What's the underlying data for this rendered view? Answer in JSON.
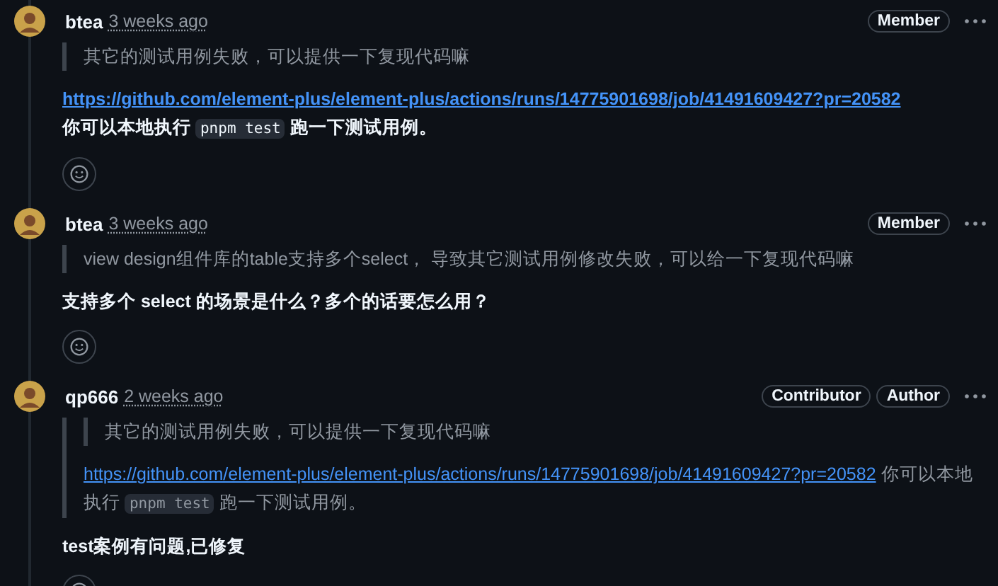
{
  "comments": [
    {
      "author": "btea",
      "time": "3 weeks ago",
      "badges": [
        "Member"
      ],
      "blocks": [
        {
          "kind": "quote",
          "children": [
            {
              "kind": "paragraph",
              "parts": [
                {
                  "kind": "text",
                  "text": "其它的测试用例失败，可以提供一下复现代码嘛"
                }
              ]
            }
          ]
        },
        {
          "kind": "paragraph",
          "parts": [
            {
              "kind": "link",
              "text": "https://github.com/element-plus/element-plus/actions/runs/14775901698/job/41491609427?pr=20582"
            },
            {
              "kind": "break"
            },
            {
              "kind": "text",
              "text": "你可以本地执行 "
            },
            {
              "kind": "code",
              "text": "pnpm test"
            },
            {
              "kind": "text",
              "text": " 跑一下测试用例。"
            }
          ]
        }
      ]
    },
    {
      "author": "btea",
      "time": "3 weeks ago",
      "badges": [
        "Member"
      ],
      "blocks": [
        {
          "kind": "quote",
          "children": [
            {
              "kind": "paragraph",
              "parts": [
                {
                  "kind": "text",
                  "text": "view design组件库的table支持多个select， 导致其它测试用例修改失败，可以给一下复现代码嘛"
                }
              ]
            }
          ]
        },
        {
          "kind": "paragraph",
          "parts": [
            {
              "kind": "text",
              "text": "支持多个 select 的场景是什么？多个的话要怎么用？"
            }
          ]
        }
      ]
    },
    {
      "author": "qp666",
      "time": "2 weeks ago",
      "badges": [
        "Contributor",
        "Author"
      ],
      "blocks": [
        {
          "kind": "quote",
          "children": [
            {
              "kind": "quote",
              "children": [
                {
                  "kind": "paragraph",
                  "parts": [
                    {
                      "kind": "text",
                      "text": "其它的测试用例失败，可以提供一下复现代码嘛"
                    }
                  ]
                }
              ]
            },
            {
              "kind": "paragraph",
              "parts": [
                {
                  "kind": "link",
                  "text": "https://github.com/element-plus/element-plus/actions/runs/14775901698/job/41491609427?pr=20582"
                },
                {
                  "kind": "text",
                  "text": " 你可以本地执行 "
                },
                {
                  "kind": "code",
                  "text": "pnpm test"
                },
                {
                  "kind": "text",
                  "text": " 跑一下测试用例。"
                }
              ]
            }
          ]
        },
        {
          "kind": "paragraph",
          "parts": [
            {
              "kind": "text",
              "text": "test案例有问题,已修复"
            }
          ]
        }
      ]
    }
  ]
}
